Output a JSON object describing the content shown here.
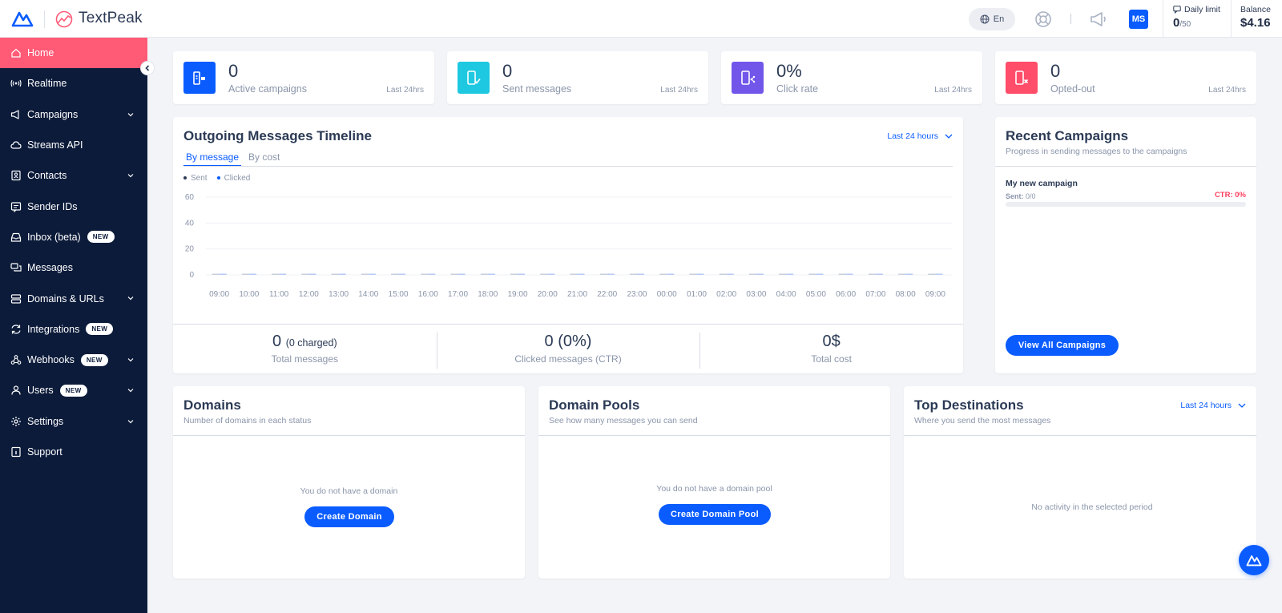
{
  "header": {
    "brand": "TextPeak",
    "language": "En",
    "avatar_initials": "MS",
    "daily_limit": {
      "label": "Daily limit",
      "used": "0",
      "max": "/50"
    },
    "balance": {
      "label": "Balance",
      "value": "$4.16"
    }
  },
  "sidebar": {
    "items": [
      {
        "label": "Home",
        "icon": "home-icon",
        "active": true
      },
      {
        "label": "Realtime",
        "icon": "broadcast-icon"
      },
      {
        "label": "Campaigns",
        "icon": "megaphone-icon",
        "expandable": true
      },
      {
        "label": "Streams API",
        "icon": "cloud-icon"
      },
      {
        "label": "Contacts",
        "icon": "contacts-icon",
        "expandable": true
      },
      {
        "label": "Sender IDs",
        "icon": "id-card-icon"
      },
      {
        "label": "Inbox (beta)",
        "icon": "inbox-icon",
        "badge": "NEW"
      },
      {
        "label": "Messages",
        "icon": "chat-icon"
      },
      {
        "label": "Domains & URLs",
        "icon": "server-icon",
        "expandable": true
      },
      {
        "label": "Integrations",
        "icon": "sync-icon",
        "badge": "NEW"
      },
      {
        "label": "Webhooks",
        "icon": "webhook-icon",
        "badge": "NEW",
        "expandable": true
      },
      {
        "label": "Users",
        "icon": "user-icon",
        "badge": "NEW",
        "expandable": true
      },
      {
        "label": "Settings",
        "icon": "gear-icon",
        "expandable": true
      },
      {
        "label": "Support",
        "icon": "support-icon"
      }
    ]
  },
  "stats": [
    {
      "value": "0",
      "label": "Active campaigns",
      "period": "Last 24hrs",
      "color": "#0a5cff"
    },
    {
      "value": "0",
      "label": "Sent messages",
      "period": "Last 24hrs",
      "color": "#1ec8e0"
    },
    {
      "value": "0%",
      "label": "Click rate",
      "period": "Last 24hrs",
      "color": "#7256ea"
    },
    {
      "value": "0",
      "label": "Opted-out",
      "period": "Last 24hrs",
      "color": "#ff4d6a"
    }
  ],
  "timeline": {
    "title": "Outgoing Messages Timeline",
    "period": "Last 24 hours",
    "tabs": [
      "By message",
      "By cost"
    ],
    "summary": {
      "total_messages": "0",
      "total_charged": "(0 charged)",
      "total_messages_label": "Total messages",
      "clicked": "0 (0%)",
      "clicked_label": "Clicked messages (CTR)",
      "cost": "0$",
      "cost_label": "Total cost"
    }
  },
  "chart_data": {
    "type": "bar",
    "categories": [
      "09:00",
      "10:00",
      "11:00",
      "12:00",
      "13:00",
      "14:00",
      "15:00",
      "16:00",
      "17:00",
      "18:00",
      "19:00",
      "20:00",
      "21:00",
      "22:00",
      "23:00",
      "00:00",
      "01:00",
      "02:00",
      "03:00",
      "04:00",
      "05:00",
      "06:00",
      "07:00",
      "08:00",
      "09:00"
    ],
    "series": [
      {
        "name": "Sent",
        "values": [
          0,
          0,
          0,
          0,
          0,
          0,
          0,
          0,
          0,
          0,
          0,
          0,
          0,
          0,
          0,
          0,
          0,
          0,
          0,
          0,
          0,
          0,
          0,
          0,
          0
        ],
        "color": "#2b3a55"
      },
      {
        "name": "Clicked",
        "values": [
          0,
          0,
          0,
          0,
          0,
          0,
          0,
          0,
          0,
          0,
          0,
          0,
          0,
          0,
          0,
          0,
          0,
          0,
          0,
          0,
          0,
          0,
          0,
          0,
          0
        ],
        "color": "#0a5cff"
      }
    ],
    "yticks": [
      0,
      20,
      40,
      60
    ],
    "ylim": [
      0,
      60
    ],
    "legend": "top-left",
    "grid": true
  },
  "recent_campaigns": {
    "title": "Recent Campaigns",
    "subtitle": "Progress in sending messages to the campaigns",
    "campaign": {
      "name": "My new campaign",
      "sent_label": "Sent:",
      "sent_value": "0/0",
      "ctr": "CTR: 0%",
      "progress": 0
    },
    "button": "View All Campaigns"
  },
  "domains": {
    "title": "Domains",
    "subtitle": "Number of domains in each status",
    "empty": "You do not have a domain",
    "button": "Create Domain"
  },
  "domain_pools": {
    "title": "Domain Pools",
    "subtitle": "See how many messages you can send",
    "empty": "You do not have a domain pool",
    "button": "Create Domain Pool"
  },
  "top_destinations": {
    "title": "Top Destinations",
    "subtitle": "Where you send the most messages",
    "period": "Last 24 hours",
    "empty": "No activity in the selected period"
  }
}
